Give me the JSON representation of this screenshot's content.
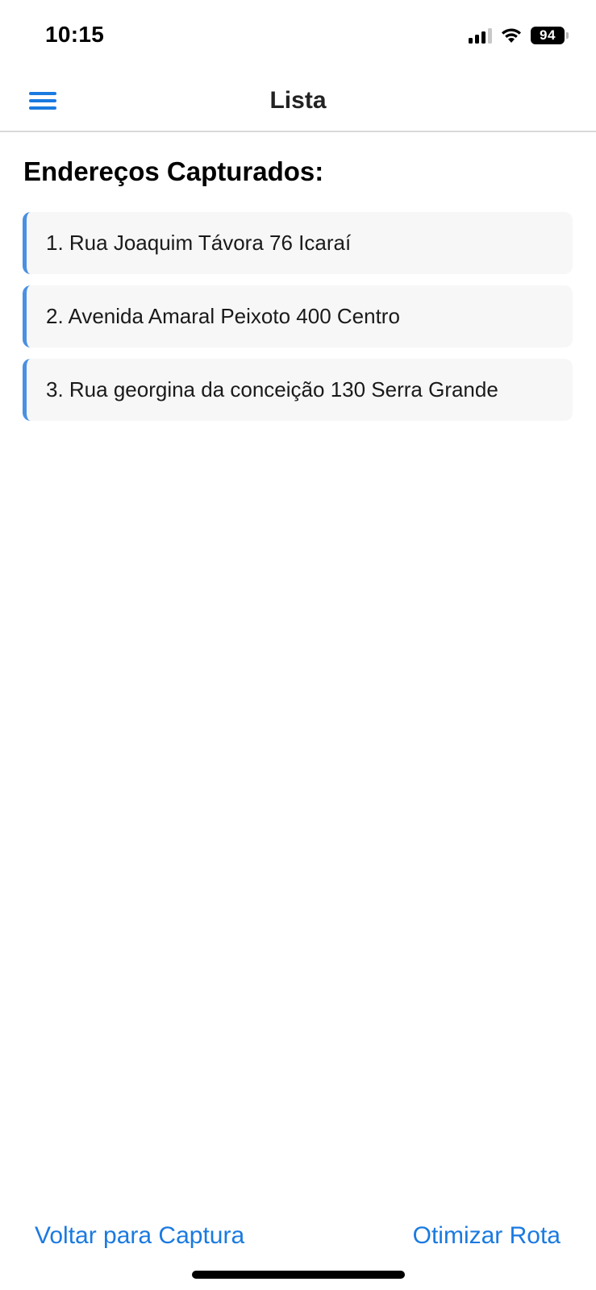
{
  "status_bar": {
    "time": "10:15",
    "battery": "94",
    "icons": [
      "signal-icon",
      "wifi-icon",
      "battery-icon"
    ]
  },
  "nav": {
    "title": "Lista",
    "menu_icon": "hamburger-menu-icon"
  },
  "main": {
    "section_title": "Endereços Capturados:",
    "addresses": [
      "1. Rua Joaquim Távora 76 Icaraí",
      "2. Avenida Amaral Peixoto 400 Centro",
      "3. Rua georgina da conceição 130 Serra Grande"
    ]
  },
  "footer": {
    "back_label": "Voltar para Captura",
    "optimize_label": "Otimizar Rota"
  },
  "colors": {
    "accent": "#1a7ae0",
    "item_border": "#4a90e2",
    "item_bg": "#f7f7f7"
  }
}
